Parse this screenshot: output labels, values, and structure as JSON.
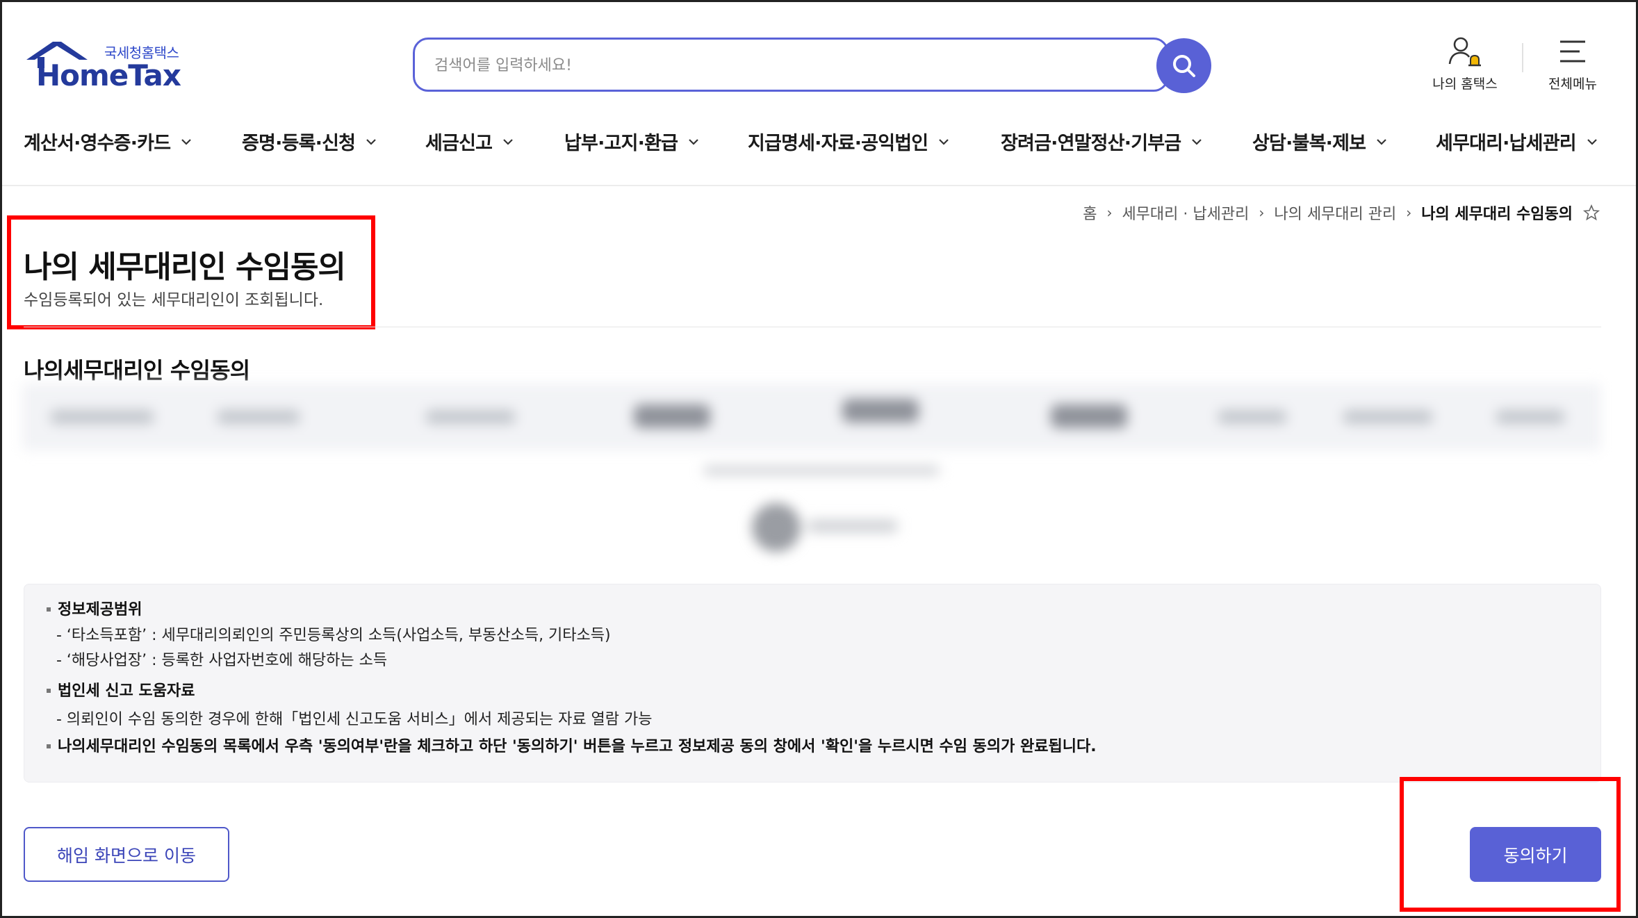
{
  "brand": {
    "sub": "국세청홈택스",
    "main": "HomeTax",
    "color": "#243a9c"
  },
  "search": {
    "placeholder": "검색어를 입력하세요!"
  },
  "top_menu": {
    "my_hometax": "나의 홈택스",
    "all_menu": "전체메뉴"
  },
  "gnb": [
    {
      "label": "계산서·영수증·카드"
    },
    {
      "label": "증명·등록·신청"
    },
    {
      "label": "세금신고"
    },
    {
      "label": "납부·고지·환급"
    },
    {
      "label": "지급명세·자료·공익법인"
    },
    {
      "label": "장려금·연말정산·기부금"
    },
    {
      "label": "상담·불복·제보"
    },
    {
      "label": "세무대리·납세관리"
    }
  ],
  "breadcrumb": [
    "홈",
    "세무대리 · 납세관리",
    "나의 세무대리 관리",
    "나의 세무대리 수임동의"
  ],
  "page": {
    "title": "나의 세무대리인 수임동의",
    "description": "수임등록되어 있는 세무대리인이 조회됩니다.",
    "section_title": "나의세무대리인 수임동의"
  },
  "info": {
    "scope_title": "정보제공범위",
    "scope_1": "- ‘타소득포함’ : 세무대리의뢰인의 주민등록상의 소득(사업소득, 부동산소득, 기타소득)",
    "scope_2": "- ‘해당사업장’ : 등록한 사업자번호에 해당하는 소득",
    "corp_title": "법인세 신고 도움자료",
    "corp_1": "- 의뢰인이 수임 동의한 경우에 한해「법인세 신고도움 서비스」에서 제공되는 자료 열람 가능",
    "notice": "나의세무대리인 수임동의 목록에서 우측 '동의여부'란을 체크하고 하단 '동의하기' 버튼을 누르고 정보제공 동의 창에서 '확인'을 누르시면 수임 동의가 완료됩니다."
  },
  "buttons": {
    "move_to_dismissal": "해임 화면으로 이동",
    "agree": "동의하기"
  },
  "colors": {
    "accent": "#5961d6",
    "highlight": "#ff0000"
  }
}
